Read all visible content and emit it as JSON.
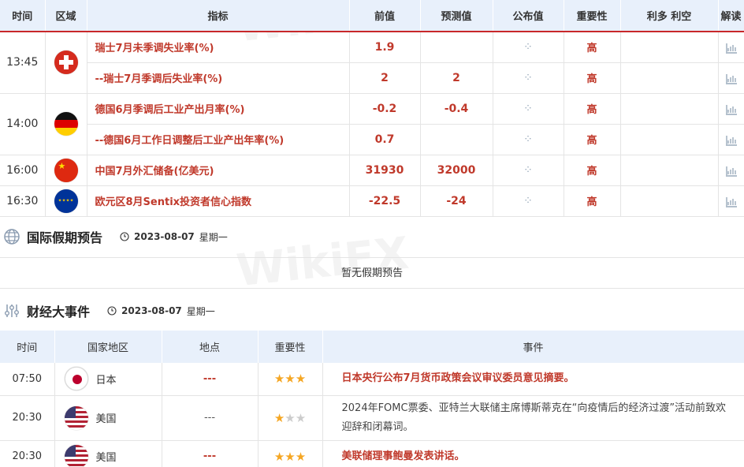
{
  "calendar": {
    "headers": [
      "时间",
      "区域",
      "指标",
      "前值",
      "预测值",
      "公布值",
      "重要性",
      "利多 利空",
      "解读"
    ],
    "rows": [
      {
        "time": "13:45",
        "indicator": "瑞士7月未季调失业率(%)",
        "prev": "1.9",
        "forecast": "",
        "importance": "高"
      },
      {
        "time": "",
        "indicator": "--瑞士7月季调后失业率(%)",
        "prev": "2",
        "forecast": "2",
        "importance": "高"
      },
      {
        "time": "14:00",
        "indicator": "德国6月季调后工业产出月率(%)",
        "prev": "-0.2",
        "forecast": "-0.4",
        "importance": "高"
      },
      {
        "time": "",
        "indicator": "--德国6月工作日调整后工业产出年率(%)",
        "prev": "0.7",
        "forecast": "",
        "importance": "高"
      },
      {
        "time": "16:00",
        "indicator": "中国7月外汇储备(亿美元)",
        "prev": "31930",
        "forecast": "32000",
        "importance": "高"
      },
      {
        "time": "16:30",
        "indicator": "欧元区8月Sentix投资者信心指数",
        "prev": "-22.5",
        "forecast": "-24",
        "importance": "高"
      }
    ]
  },
  "holiday": {
    "title": "国际假期预告",
    "date": "2023-08-07",
    "weekday": "星期一",
    "empty_text": "暂无假期预告"
  },
  "events": {
    "title": "财经大事件",
    "date": "2023-08-07",
    "weekday": "星期一",
    "headers": [
      "时间",
      "国家地区",
      "地点",
      "重要性",
      "事件"
    ],
    "rows": [
      {
        "time": "07:50",
        "country": "日本",
        "place": "---",
        "stars": 3,
        "event": "日本央行公布7月货币政策会议审议委员意见摘要。"
      },
      {
        "time": "20:30",
        "country": "美国",
        "place": "---",
        "stars": 1,
        "event": "2024年FOMC票委、亚特兰大联储主席博斯蒂克在“向疫情后的经济过渡”活动前致欢迎辞和闭幕词。"
      },
      {
        "time": "20:30",
        "country": "美国",
        "place": "---",
        "stars": 3,
        "event": "美联储理事鲍曼发表讲话。"
      }
    ]
  },
  "watermark": "WikiFX",
  "colors": {
    "accent_red": "#c0392b",
    "header_bg": "#e8f0fb",
    "star": "#f5a623"
  }
}
